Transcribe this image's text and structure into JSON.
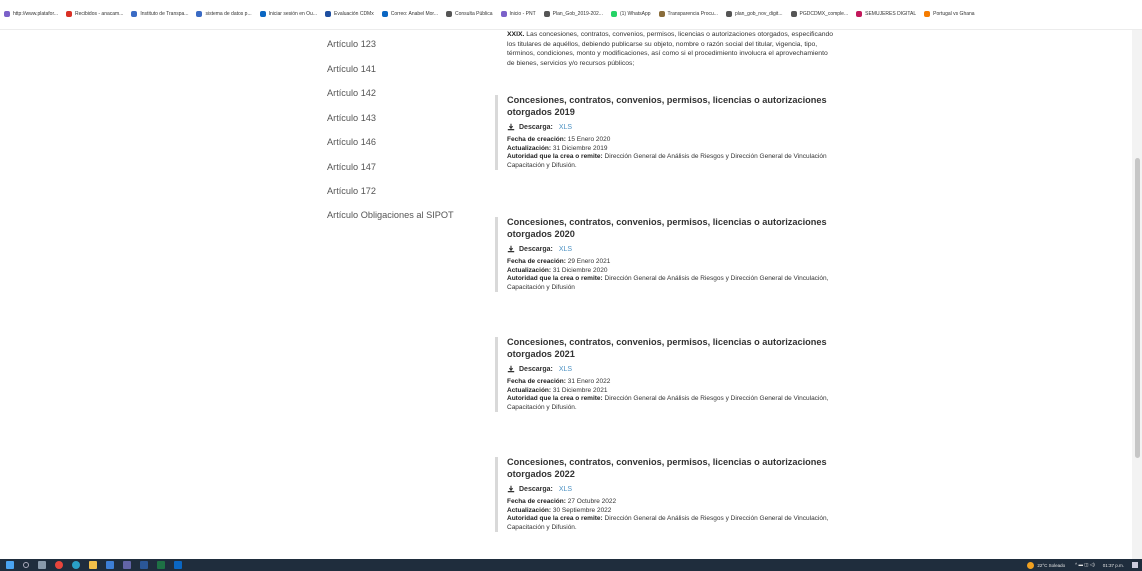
{
  "bookmarks": [
    {
      "label": "http://www.platafor...",
      "color": "#7b61c9"
    },
    {
      "label": "Recibidos - anacam...",
      "color": "#d93025"
    },
    {
      "label": "Instituto de Transpa...",
      "color": "#3a6bc4"
    },
    {
      "label": "sistema de datos p...",
      "color": "#3a6bc4"
    },
    {
      "label": "Iniciar sesión en Ou...",
      "color": "#0a66c2"
    },
    {
      "label": "Evaluación CDMx",
      "color": "#1e4fa0"
    },
    {
      "label": "Correo: Anabel Mor...",
      "color": "#0a66c2"
    },
    {
      "label": "Consulta Pública",
      "color": "#555555"
    },
    {
      "label": "Inicio - PNT",
      "color": "#7b61c9"
    },
    {
      "label": "Plan_Gob_2019-202...",
      "color": "#555555"
    },
    {
      "label": "(1) WhatsApp",
      "color": "#25d366"
    },
    {
      "label": "Transparencia Procu...",
      "color": "#8a6d3b"
    },
    {
      "label": "plan_gob_nov_digit...",
      "color": "#555555"
    },
    {
      "label": "PGDCDMX_comple...",
      "color": "#555555"
    },
    {
      "label": "SEMUJERES DIGITAL",
      "color": "#c2185b"
    },
    {
      "label": "Portugal vs Ghana",
      "color": "#f57c00"
    }
  ],
  "sidebar": {
    "items": [
      {
        "label": "Artículo 123"
      },
      {
        "label": "Artículo 141"
      },
      {
        "label": "Artículo 142"
      },
      {
        "label": "Artículo 143"
      },
      {
        "label": "Artículo 146"
      },
      {
        "label": "Artículo 147"
      },
      {
        "label": "Artículo 172"
      },
      {
        "label": "Artículo Obligaciones al SIPOT"
      }
    ]
  },
  "intro": {
    "number": "XXIX.",
    "text": "Las concesiones, contratos, convenios, permisos, licencias o autorizaciones otorgados, especificando los titulares de aquéllos, debiendo publicarse su objeto, nombre o razón social del titular, vigencia, tipo, términos, condiciones, monto y modificaciones, así como si el procedimiento involucra el aprovechamiento de bienes, servicios y/o recursos públicos;"
  },
  "labels": {
    "download": "Descarga:",
    "created": "Fecha de creación:",
    "updated": "Actualización:",
    "authority": "Autoridad que la crea o remite:"
  },
  "entries": [
    {
      "title": "Concesiones, contratos, convenios, permisos, licencias o autorizaciones otorgados 2019",
      "file": "XLS",
      "created": "15 Enero 2020",
      "updated": "31 Diciembre 2019",
      "authority": "Dirección General de Análisis de Riesgos y Dirección General de Vinculación Capacitación y Difusión."
    },
    {
      "title": "Concesiones, contratos, convenios, permisos, licencias o autorizaciones otorgados 2020",
      "file": "XLS",
      "created": "29 Enero 2021",
      "updated": "31 Diciembre 2020",
      "authority": "Dirección General de Análisis de Riesgos y Dirección General de Vinculación, Capacitación y Difusión"
    },
    {
      "title": "Concesiones, contratos, convenios, permisos, licencias o autorizaciones otorgados 2021",
      "file": "XLS",
      "created": "31 Enero 2022",
      "updated": "31 Diciembre 2021",
      "authority": "Dirección General de Análisis de Riesgos y Dirección General de Vinculación, Capacitación y Difusión."
    },
    {
      "title": "Concesiones, contratos, convenios, permisos, licencias o autorizaciones otorgados 2022",
      "file": "XLS",
      "created": "27 Octubre 2022",
      "updated": "30 Septiembre 2022",
      "authority": "Dirección General de Análisis de Riesgos y Dirección General de Vinculación, Capacitación y Difusión."
    }
  ],
  "taskbar": {
    "weather": "22°C Soleado",
    "time": "01:37 p.m."
  },
  "colors": {
    "link": "#4a90c2",
    "entry_border": "#d9d9d9",
    "taskbar": "#1f2d3d"
  }
}
